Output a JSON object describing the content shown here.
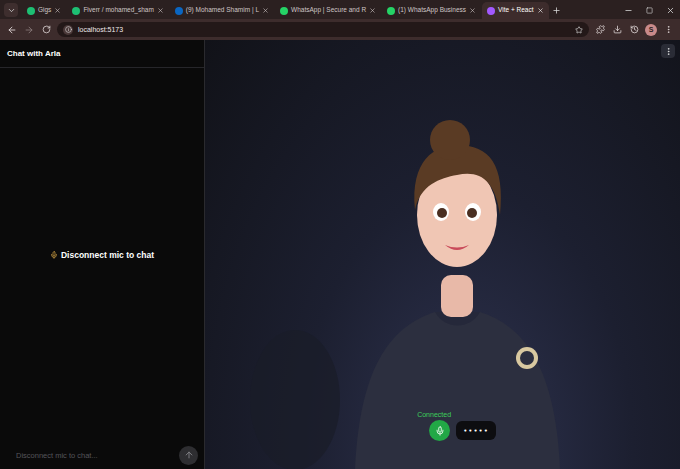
{
  "browser": {
    "tabs": [
      {
        "label": "Gigs",
        "selected": false,
        "color": "#1dbf73"
      },
      {
        "label": "Fiverr / mohamed_sham",
        "selected": false,
        "color": "#1dbf73"
      },
      {
        "label": "(9) Mohamed Shamim | L",
        "selected": false,
        "color": "#0a66c2"
      },
      {
        "label": "WhatsApp | Secure and R",
        "selected": false,
        "color": "#25d366"
      },
      {
        "label": "(1) WhatsApp Business",
        "selected": false,
        "color": "#25d366"
      },
      {
        "label": "Vite + React",
        "selected": true,
        "color": "#a259ff"
      }
    ],
    "address": "localhost:5173",
    "profile": "S"
  },
  "chat": {
    "title": "Chat with Arla",
    "message": "Disconnect mic to chat",
    "input_placeholder": "Disconnect mic to chat..."
  },
  "stage": {
    "status": "Connected",
    "mic_on": true,
    "dots": "•••••"
  }
}
